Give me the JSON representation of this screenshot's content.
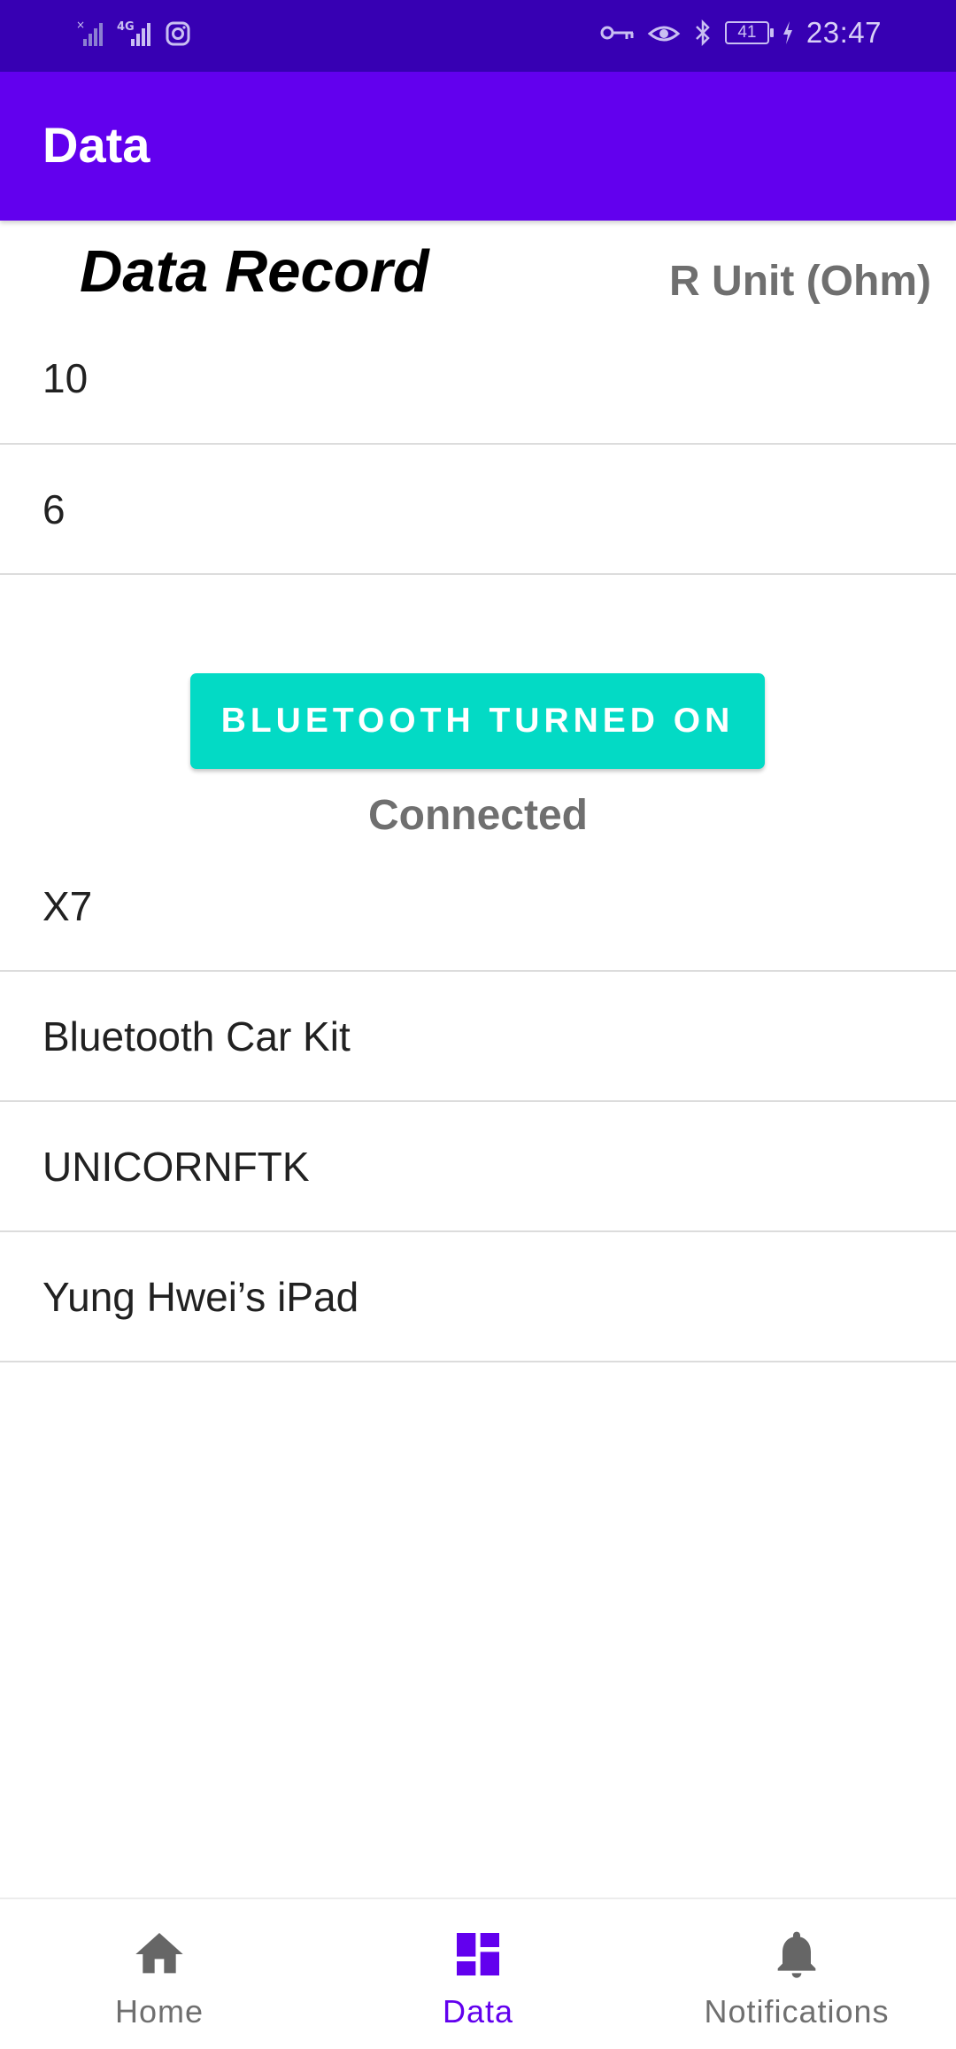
{
  "status_bar": {
    "time": "23:47",
    "battery": "41",
    "network": "4G"
  },
  "app_bar": {
    "title": "Data"
  },
  "header": {
    "title": "Data Record",
    "unit": "R Unit (Ohm)"
  },
  "data_records": [
    "10",
    "6"
  ],
  "bluetooth": {
    "button_label": "BLUETOOTH TURNED ON",
    "status": "Connected"
  },
  "devices": [
    "X7",
    "Bluetooth Car Kit",
    "UNICORNFTK",
    "Yung Hwei’s iPad"
  ],
  "bottom_nav": {
    "items": [
      {
        "label": "Home",
        "icon": "home-icon"
      },
      {
        "label": "Data",
        "icon": "dashboard-icon"
      },
      {
        "label": "Notifications",
        "icon": "bell-icon"
      }
    ],
    "active": "Data"
  },
  "colors": {
    "primary": "#6200ee",
    "primary_dark": "#3700b3",
    "accent": "#03dac5"
  }
}
